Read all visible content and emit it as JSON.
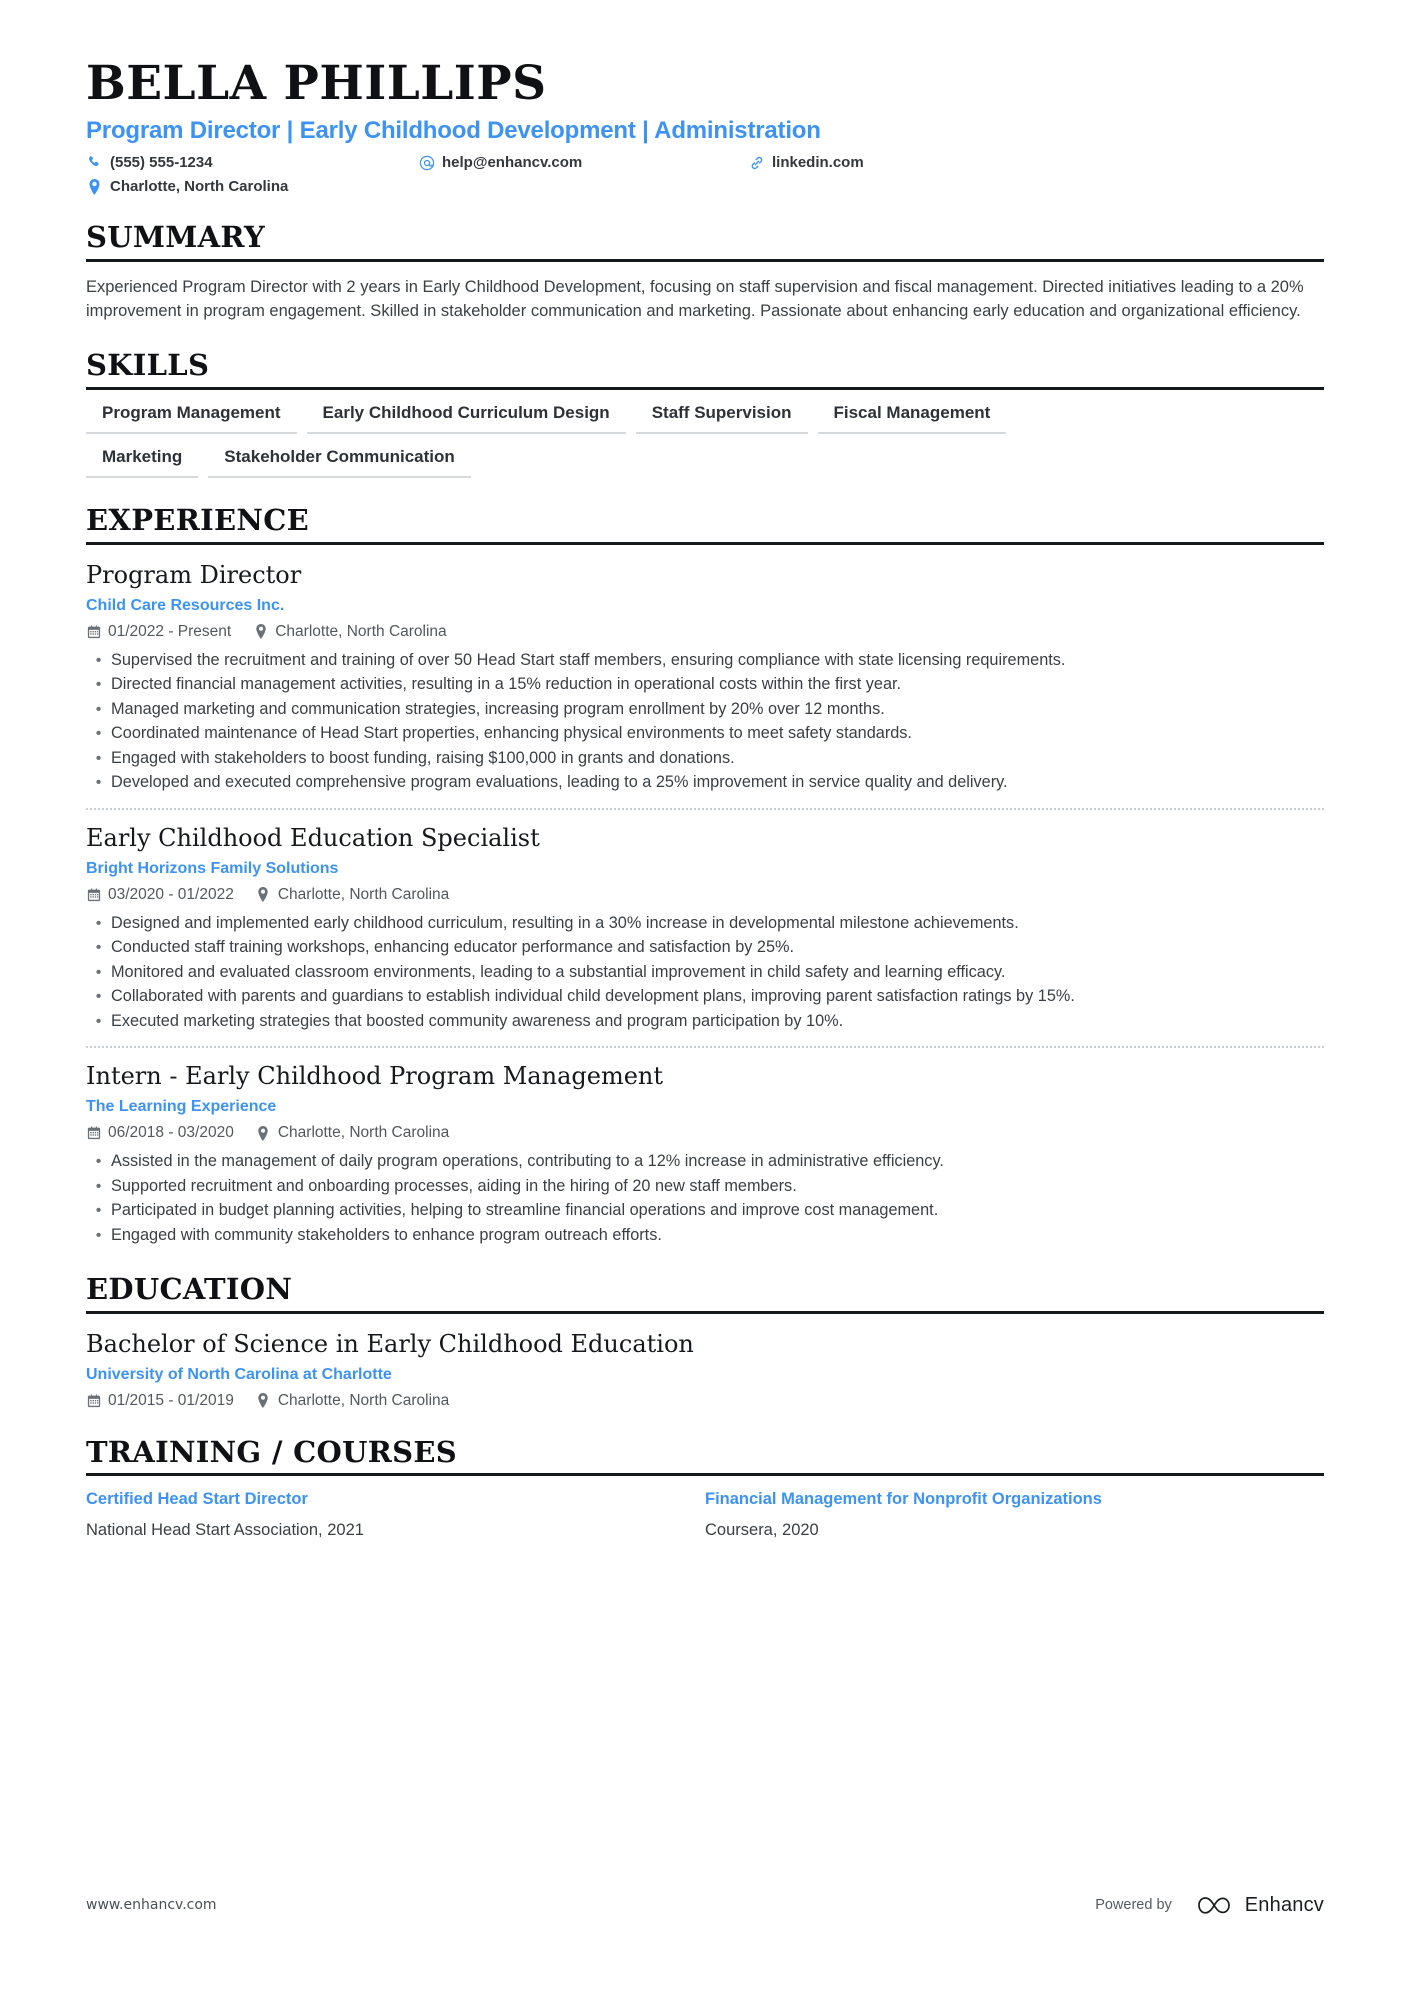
{
  "header": {
    "name": "BELLA PHILLIPS",
    "headline": "Program Director | Early Childhood Development | Administration",
    "contacts": [
      {
        "icon": "phone-icon",
        "value": "(555) 555-1234"
      },
      {
        "icon": "email-icon",
        "value": "help@enhancv.com"
      },
      {
        "icon": "link-icon",
        "value": "linkedin.com"
      },
      {
        "icon": "location-icon",
        "value": "Charlotte, North Carolina"
      }
    ]
  },
  "colors": {
    "accent": "#3d93f5",
    "heading": "#0f1114",
    "body": "#3a3f45",
    "rule": "#16191c",
    "skill_underline": "#d6d9dc",
    "divider": "#c9ced3"
  },
  "summary": {
    "title": "SUMMARY",
    "text": "Experienced Program Director with 2 years in Early Childhood Development, focusing on staff supervision and fiscal management. Directed initiatives leading to a 20% improvement in program engagement. Skilled in stakeholder communication and marketing. Passionate about enhancing early education and organizational efficiency."
  },
  "skills": {
    "title": "SKILLS",
    "rows": [
      [
        "Program Management",
        "Early Childhood Curriculum Design",
        "Staff Supervision",
        "Fiscal Management"
      ],
      [
        "Marketing",
        "Stakeholder Communication"
      ]
    ]
  },
  "experience": {
    "title": "EXPERIENCE",
    "entries": [
      {
        "role": "Program Director",
        "company": "Child Care Resources Inc.",
        "dates": "01/2022 - Present",
        "location": "Charlotte, North Carolina",
        "bullets": [
          "Supervised the recruitment and training of over 50 Head Start staff members, ensuring compliance with state licensing requirements.",
          "Directed financial management activities, resulting in a 15% reduction in operational costs within the first year.",
          "Managed marketing and communication strategies, increasing program enrollment by 20% over 12 months.",
          "Coordinated maintenance of Head Start properties, enhancing physical environments to meet safety standards.",
          "Engaged with stakeholders to boost funding, raising $100,000 in grants and donations.",
          "Developed and executed comprehensive program evaluations, leading to a 25% improvement in service quality and delivery."
        ]
      },
      {
        "role": "Early Childhood Education Specialist",
        "company": "Bright Horizons Family Solutions",
        "dates": "03/2020 - 01/2022",
        "location": "Charlotte, North Carolina",
        "bullets": [
          "Designed and implemented early childhood curriculum, resulting in a 30% increase in developmental milestone achievements.",
          "Conducted staff training workshops, enhancing educator performance and satisfaction by 25%.",
          "Monitored and evaluated classroom environments, leading to a substantial improvement in child safety and learning efficacy.",
          "Collaborated with parents and guardians to establish individual child development plans, improving parent satisfaction ratings by 15%.",
          "Executed marketing strategies that boosted community awareness and program participation by 10%."
        ]
      },
      {
        "role": "Intern - Early Childhood Program Management",
        "company": "The Learning Experience",
        "dates": "06/2018 - 03/2020",
        "location": "Charlotte, North Carolina",
        "bullets": [
          "Assisted in the management of daily program operations, contributing to a 12% increase in administrative efficiency.",
          "Supported recruitment and onboarding processes, aiding in the hiring of 20 new staff members.",
          "Participated in budget planning activities, helping to streamline financial operations and improve cost management.",
          "Engaged with community stakeholders to enhance program outreach efforts."
        ]
      }
    ]
  },
  "education": {
    "title": "EDUCATION",
    "entries": [
      {
        "degree": "Bachelor of Science in Early Childhood Education",
        "school": "University of North Carolina at Charlotte",
        "dates": "01/2015 - 01/2019",
        "location": "Charlotte, North Carolina"
      }
    ]
  },
  "training": {
    "title": "TRAINING / COURSES",
    "courses": [
      {
        "name": "Certified Head Start Director",
        "meta": "National Head Start Association, 2021"
      },
      {
        "name": "Financial Management for Nonprofit Organizations",
        "meta": "Coursera, 2020"
      }
    ]
  },
  "footer": {
    "url": "www.enhancv.com",
    "powered_by": "Powered by",
    "brand": "Enhancv"
  }
}
